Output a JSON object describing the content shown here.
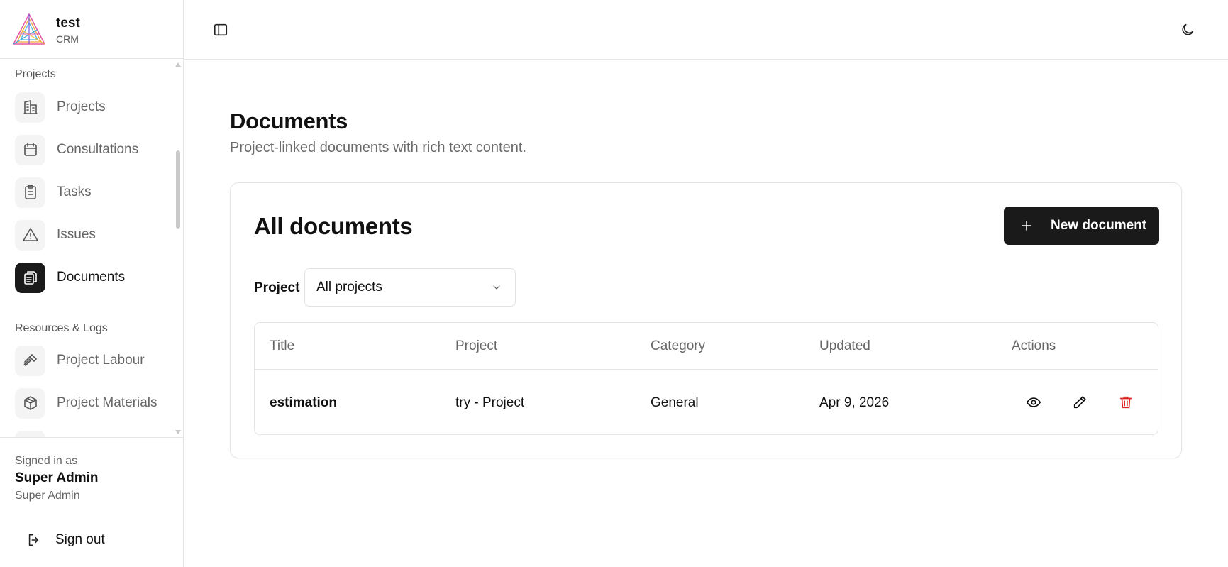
{
  "brand": {
    "name": "test",
    "subtitle": "CRM"
  },
  "sidebar": {
    "section_projects": "Projects",
    "items": [
      {
        "label": "Projects",
        "icon": "building-icon"
      },
      {
        "label": "Consultations",
        "icon": "calendar-icon"
      },
      {
        "label": "Tasks",
        "icon": "clipboard-icon"
      },
      {
        "label": "Issues",
        "icon": "warning-icon"
      },
      {
        "label": "Documents",
        "icon": "documents-icon",
        "active": true
      }
    ],
    "section_resources": "Resources & Logs",
    "resource_items": [
      {
        "label": "Project Labour",
        "icon": "hammer-icon"
      },
      {
        "label": "Project Materials",
        "icon": "package-icon"
      }
    ]
  },
  "user": {
    "signed_in_label": "Signed in as",
    "name": "Super Admin",
    "role": "Super Admin",
    "sign_out_label": "Sign out"
  },
  "page": {
    "title": "Documents",
    "subtitle": "Project-linked documents with rich text content."
  },
  "card": {
    "title": "All documents",
    "new_button_label": "New document",
    "filter_label": "Project",
    "filter_value": "All projects"
  },
  "table": {
    "columns": [
      "Title",
      "Project",
      "Category",
      "Updated",
      "Actions"
    ],
    "rows": [
      {
        "title": "estimation",
        "project": "try - Project",
        "category": "General",
        "updated": "Apr 9, 2026"
      }
    ]
  },
  "colors": {
    "accent": "#1a1a1a",
    "danger": "#dc2626",
    "muted_text": "#666666"
  }
}
